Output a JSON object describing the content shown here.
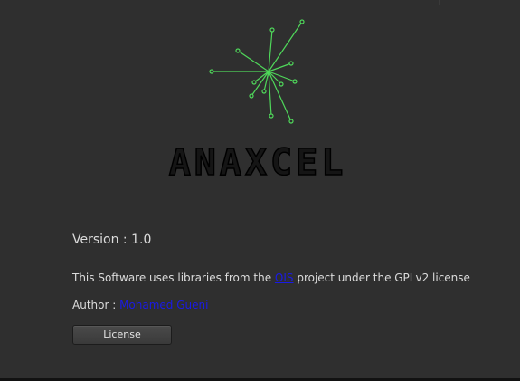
{
  "logo": {
    "wordmark": "ANAXCEL",
    "icon_name": "node-network-burst-icon",
    "accent_color": "#4fd85a"
  },
  "info": {
    "version_text": "Version : 1.0",
    "lib_prefix": "This Software uses libraries from the ",
    "lib_link": "OIS",
    "lib_suffix": " project under the GPLv2 license",
    "author_prefix": "Author : ",
    "author_link": "Mohamed Gueni "
  },
  "buttons": {
    "license_label": "License"
  },
  "colors": {
    "background": "#2f2f2f",
    "text": "#dcdcdc",
    "link": "#1a1ae6",
    "wordmark_fill": "#151515"
  }
}
